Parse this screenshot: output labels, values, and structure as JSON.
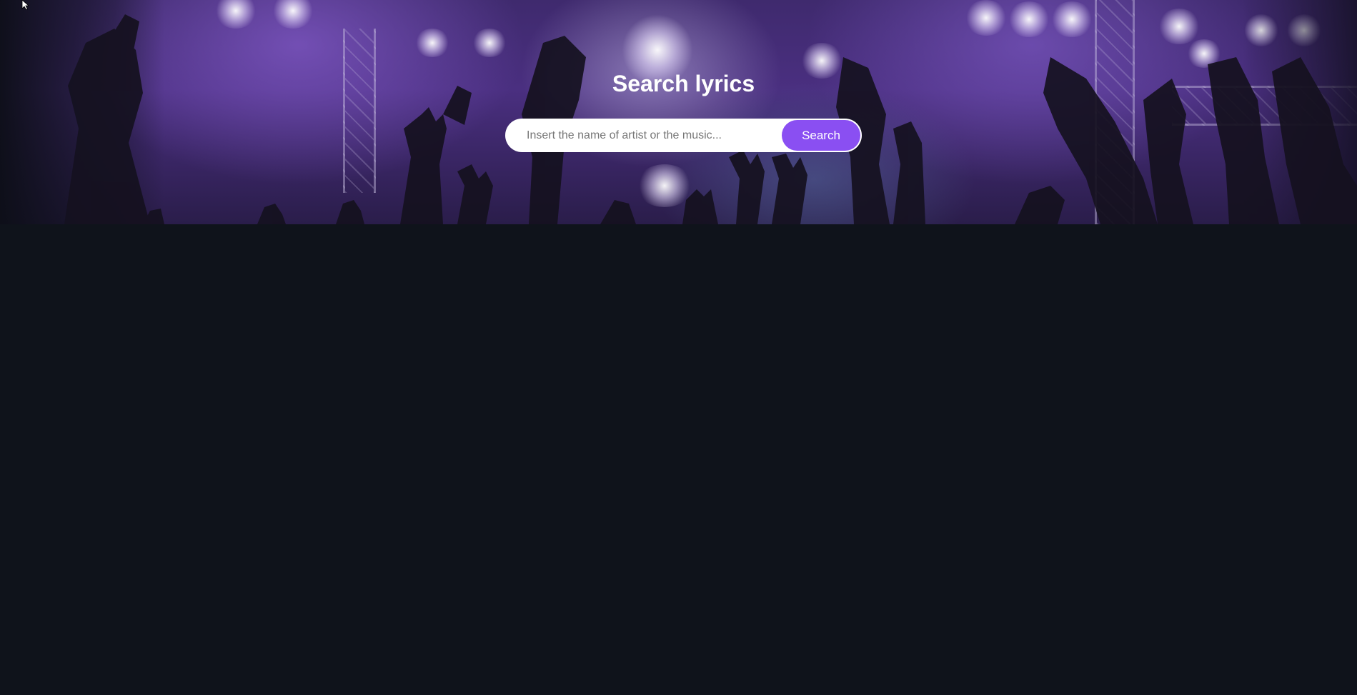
{
  "header": {
    "title": "Search lyrics"
  },
  "search": {
    "placeholder": "Insert the name of artist or the music...",
    "value": "",
    "button_label": "Search"
  },
  "colors": {
    "accent": "#8a4ff2",
    "page_background": "#0f131b",
    "hero_tint": "#4a2f80"
  },
  "icons": {
    "cursor": "mouse-pointer-icon"
  }
}
